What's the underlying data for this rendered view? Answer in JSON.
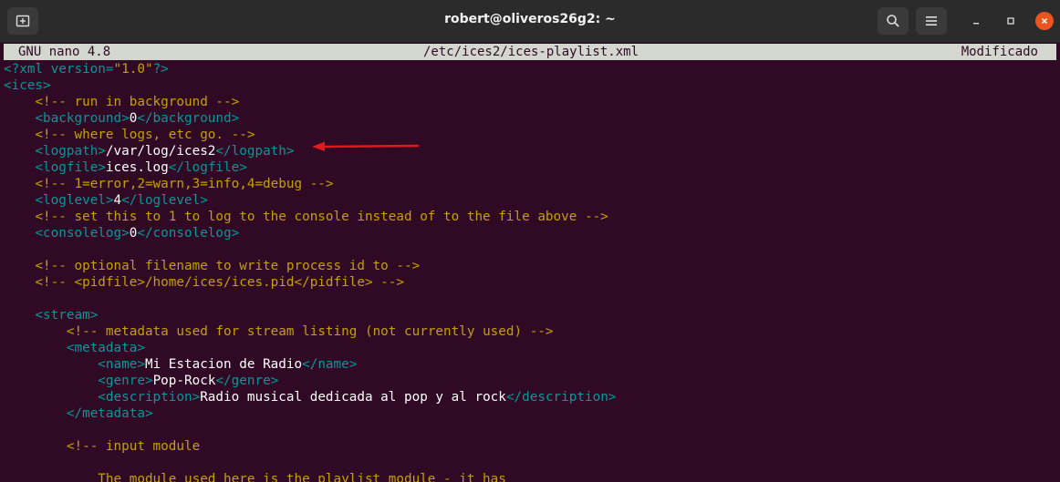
{
  "window": {
    "title": "robert@oliveros26g2: ~",
    "new_tab_icon": "new-tab-icon",
    "search_icon": "search-icon",
    "menu_icon": "hamburger-menu-icon"
  },
  "nano": {
    "version": "GNU nano 4.8",
    "file": "/etc/ices2/ices-playlist.xml",
    "status": "Modificado"
  },
  "colors": {
    "background": "#300a24",
    "tag": "#06989a",
    "comment": "#c4a000",
    "close_button": "#e95420",
    "annotation_arrow": "#e0191e"
  },
  "lines": [
    [
      {
        "t": "pi",
        "v": "<?xml version="
      },
      {
        "t": "str",
        "v": "\"1.0\""
      },
      {
        "t": "pi",
        "v": "?>"
      }
    ],
    [
      {
        "t": "tag",
        "v": "<ices>"
      }
    ],
    [
      {
        "t": "text",
        "v": "    "
      },
      {
        "t": "comment",
        "v": "<!-- run in background -->"
      }
    ],
    [
      {
        "t": "text",
        "v": "    "
      },
      {
        "t": "tag",
        "v": "<background>"
      },
      {
        "t": "text",
        "v": "0"
      },
      {
        "t": "tag",
        "v": "</background>"
      }
    ],
    [
      {
        "t": "text",
        "v": "    "
      },
      {
        "t": "comment",
        "v": "<!-- where logs, etc go. -->"
      }
    ],
    [
      {
        "t": "text",
        "v": "    "
      },
      {
        "t": "tag",
        "v": "<logpath>"
      },
      {
        "t": "text",
        "v": "/var/log/ices2"
      },
      {
        "t": "tag",
        "v": "</logpath>"
      }
    ],
    [
      {
        "t": "text",
        "v": "    "
      },
      {
        "t": "tag",
        "v": "<logfile>"
      },
      {
        "t": "text",
        "v": "ices.log"
      },
      {
        "t": "tag",
        "v": "</logfile>"
      }
    ],
    [
      {
        "t": "text",
        "v": "    "
      },
      {
        "t": "comment",
        "v": "<!-- 1=error,2=warn,3=info,4=debug -->"
      }
    ],
    [
      {
        "t": "text",
        "v": "    "
      },
      {
        "t": "tag",
        "v": "<loglevel>"
      },
      {
        "t": "text",
        "v": "4"
      },
      {
        "t": "tag",
        "v": "</loglevel>"
      }
    ],
    [
      {
        "t": "text",
        "v": "    "
      },
      {
        "t": "comment",
        "v": "<!-- set this to 1 to log to the console instead of to the file above -->"
      }
    ],
    [
      {
        "t": "text",
        "v": "    "
      },
      {
        "t": "tag",
        "v": "<consolelog>"
      },
      {
        "t": "text",
        "v": "0"
      },
      {
        "t": "tag",
        "v": "</consolelog>"
      }
    ],
    [
      {
        "t": "text",
        "v": ""
      }
    ],
    [
      {
        "t": "text",
        "v": "    "
      },
      {
        "t": "comment",
        "v": "<!-- optional filename to write process id to -->"
      }
    ],
    [
      {
        "t": "text",
        "v": "    "
      },
      {
        "t": "comment",
        "v": "<!-- <pidfile>/home/ices/ices.pid</pidfile> -->"
      }
    ],
    [
      {
        "t": "text",
        "v": ""
      }
    ],
    [
      {
        "t": "text",
        "v": "    "
      },
      {
        "t": "tag",
        "v": "<stream>"
      }
    ],
    [
      {
        "t": "text",
        "v": "        "
      },
      {
        "t": "comment",
        "v": "<!-- metadata used for stream listing (not currently used) -->"
      }
    ],
    [
      {
        "t": "text",
        "v": "        "
      },
      {
        "t": "tag",
        "v": "<metadata>"
      }
    ],
    [
      {
        "t": "text",
        "v": "            "
      },
      {
        "t": "tag",
        "v": "<name>"
      },
      {
        "t": "text",
        "v": "Mi Estacion de Radio"
      },
      {
        "t": "tag",
        "v": "</name>"
      }
    ],
    [
      {
        "t": "text",
        "v": "            "
      },
      {
        "t": "tag",
        "v": "<genre>"
      },
      {
        "t": "text",
        "v": "Pop-Rock"
      },
      {
        "t": "tag",
        "v": "</genre>"
      }
    ],
    [
      {
        "t": "text",
        "v": "            "
      },
      {
        "t": "tag",
        "v": "<description>"
      },
      {
        "t": "text",
        "v": "Radio musical dedicada al pop y al rock"
      },
      {
        "t": "tag",
        "v": "</description>"
      }
    ],
    [
      {
        "t": "text",
        "v": "        "
      },
      {
        "t": "tag",
        "v": "</metadata>"
      }
    ],
    [
      {
        "t": "text",
        "v": ""
      }
    ],
    [
      {
        "t": "text",
        "v": "        "
      },
      {
        "t": "comment",
        "v": "<!-- input module"
      }
    ],
    [
      {
        "t": "text",
        "v": ""
      }
    ],
    [
      {
        "t": "text",
        "v": "            "
      },
      {
        "t": "comment",
        "v": "The module used here is the playlist module - it has"
      }
    ]
  ]
}
